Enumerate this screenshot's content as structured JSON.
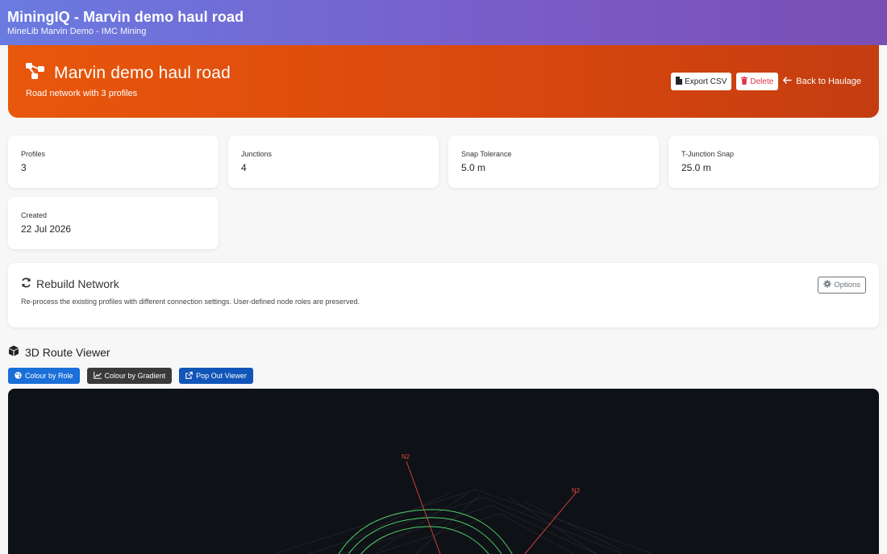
{
  "topbar": {
    "title": "MiningIQ - Marvin demo haul road",
    "subtitle": "MineLib Marvin Demo - IMC Mining"
  },
  "hero": {
    "title": "Marvin demo haul road",
    "subtitle": "Road network with 3 profiles",
    "export_label": "Export CSV",
    "delete_label": "Delete",
    "back_label": "Back to Haulage"
  },
  "stats": [
    {
      "label": "Profiles",
      "value": "3"
    },
    {
      "label": "Junctions",
      "value": "4"
    },
    {
      "label": "Snap Tolerance",
      "value": "5.0 m"
    },
    {
      "label": "T-Junction Snap",
      "value": "25.0 m"
    },
    {
      "label": "Created",
      "value": "22 Jul 2026"
    }
  ],
  "rebuild": {
    "title": "Rebuild Network",
    "description": "Re-process the existing profiles with different connection settings. User-defined node roles are preserved.",
    "options_label": "Options"
  },
  "viewer": {
    "title": "3D Route Viewer",
    "buttons": {
      "role": "Colour by Role",
      "gradient": "Colour by Gradient",
      "popout": "Pop Out Viewer"
    },
    "nodes": [
      "N2",
      "N3"
    ],
    "colors": {
      "background": "#0e1116",
      "route": "#4fd06a",
      "node_line": "#e0463c",
      "grid": "#2a2f36"
    }
  },
  "colors": {
    "accent": "#e8570c",
    "primary": "#1a6fd8"
  }
}
